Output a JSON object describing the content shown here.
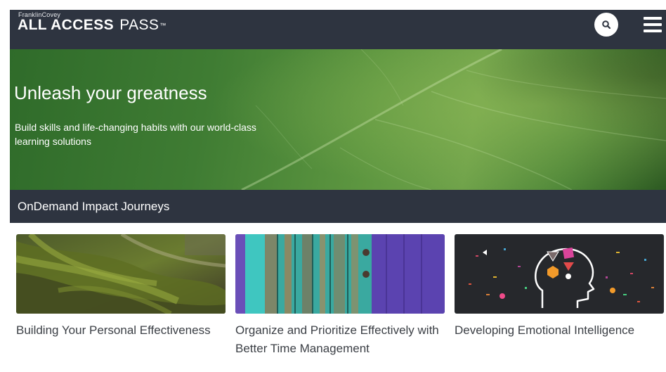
{
  "header": {
    "brand_small": "FranklinCovey",
    "brand_bold": "ALL ACCESS",
    "brand_light": "PASS",
    "brand_tm": "™",
    "search_icon": "search-icon",
    "menu_icon": "hamburger-menu-icon",
    "background_color": "#2e3440"
  },
  "hero": {
    "title": "Unleash your greatness",
    "subtitle": "Build skills and life-changing habits with our world-class learning solutions"
  },
  "section": {
    "title": "OnDemand Impact Journeys"
  },
  "cards": [
    {
      "title": "Building Your Personal Effectiveness",
      "image": "mossy-tree-roots-image"
    },
    {
      "title": "Organize and Prioritize Effectively with Better Time Management",
      "image": "weathered-wooden-door-image"
    },
    {
      "title": "Developing Emotional Intelligence",
      "image": "head-brain-illustration-image"
    }
  ],
  "colors": {
    "accent_dark": "#2e3440",
    "card_text": "#3b3f45"
  }
}
